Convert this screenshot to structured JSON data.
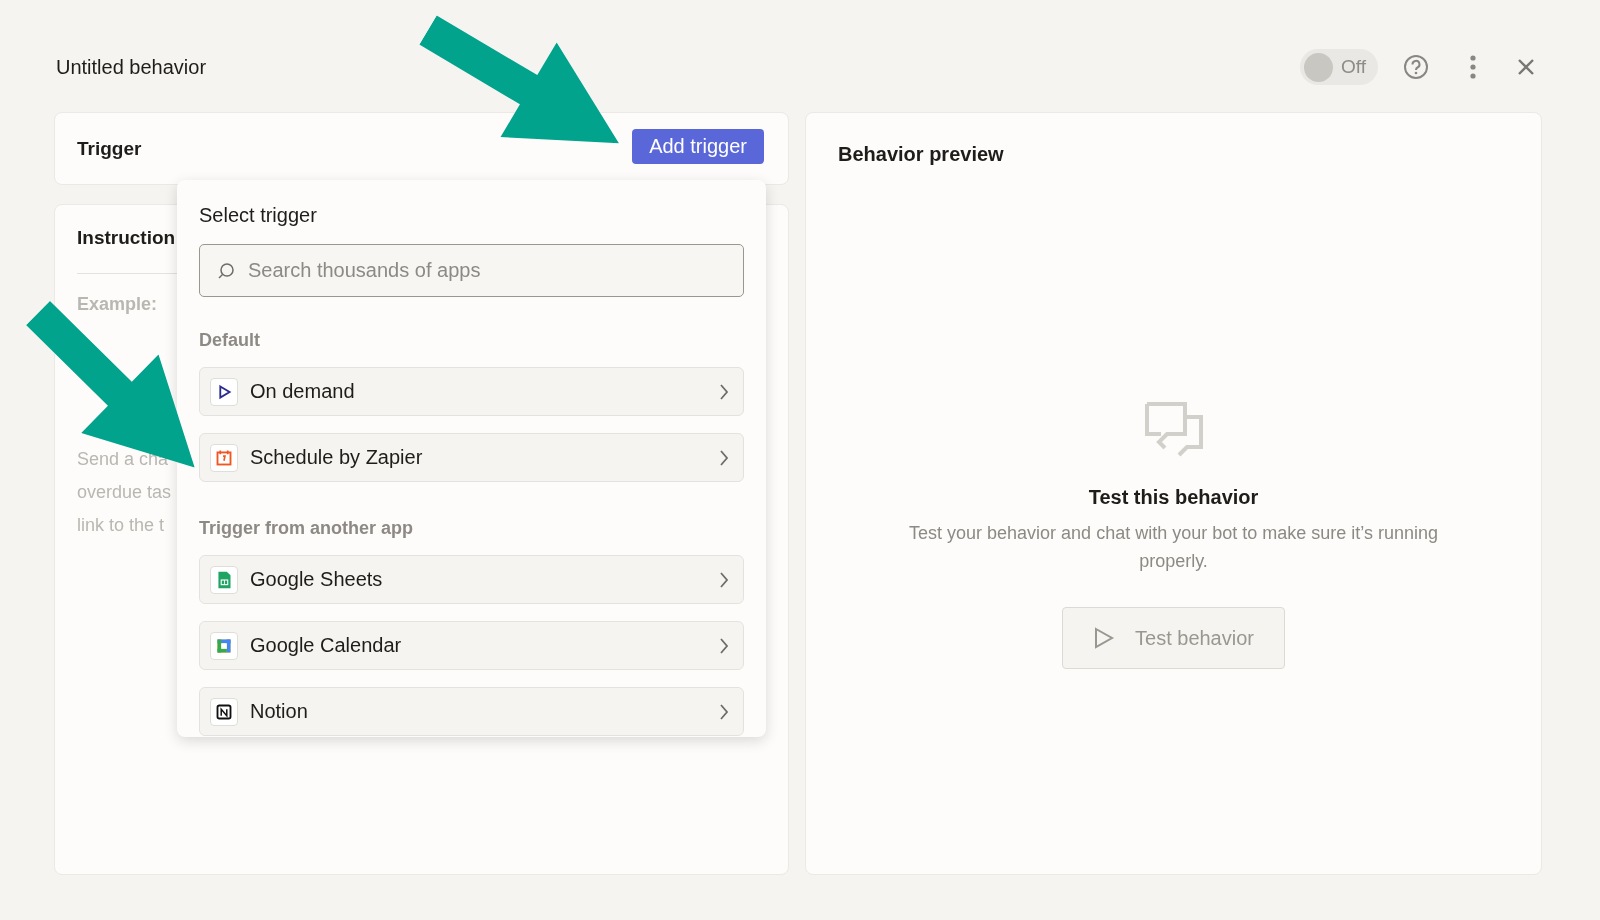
{
  "window": {
    "title": "Untitled behavior"
  },
  "toggle": {
    "label": "Off",
    "on": false
  },
  "trigger": {
    "title": "Trigger",
    "button": "Add trigger"
  },
  "instructions": {
    "title": "Instruction",
    "example_label": "Example:",
    "lines": [
      "Send a cha",
      "overdue tas",
      "link to the t"
    ]
  },
  "menu": {
    "title": "Select trigger",
    "search": {
      "placeholder": "Search thousands of apps"
    },
    "sections": [
      {
        "heading": "Default",
        "items": [
          {
            "label": "On demand"
          },
          {
            "label": "Schedule by Zapier"
          }
        ]
      },
      {
        "heading": "Trigger from another app",
        "items": [
          {
            "label": "Google Sheets"
          },
          {
            "label": "Google Calendar"
          },
          {
            "label": "Notion"
          }
        ]
      }
    ]
  },
  "preview": {
    "title": "Behavior preview",
    "empty_title": "Test this behavior",
    "empty_text": "Test your behavior and chat with your bot to make sure it’s running properly.",
    "button": {
      "label": "Test behavior",
      "disabled": true
    }
  }
}
